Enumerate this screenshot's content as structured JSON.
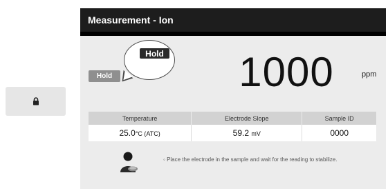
{
  "window": {
    "title": "Measurement - Ion"
  },
  "status": {
    "hold_label": "Hold"
  },
  "callout": {
    "key_label": "Hold"
  },
  "reading": {
    "value": "1000",
    "unit": "ppm"
  },
  "table": {
    "headers": [
      "Temperature",
      "Electrode Slope",
      "Sample ID"
    ],
    "temperature": {
      "value": "25.0",
      "unit": "°C (ATC)"
    },
    "slope": {
      "value": "59.2",
      "unit": "mV"
    },
    "sample_id": "0000"
  },
  "message": "Place the electrode in the sample and wait for the reading to stabilize.",
  "icons": {
    "side_button": "lock-icon",
    "operator": "operator-icon"
  },
  "colors": {
    "titlebar": "#1d1d1d",
    "panel": "#ececec",
    "hold_badge": "#8f8f8f"
  }
}
